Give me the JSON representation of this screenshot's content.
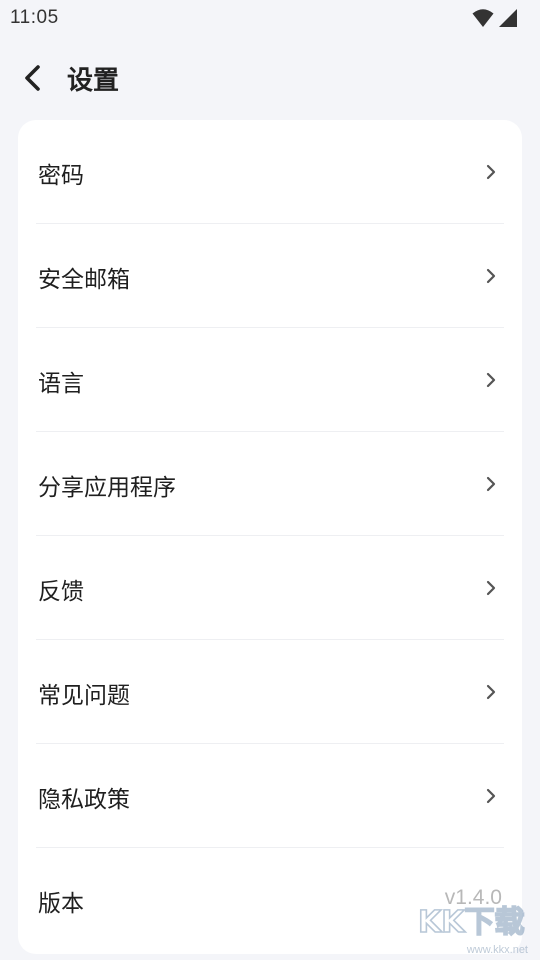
{
  "status_bar": {
    "time": "11:05",
    "icons": [
      "wifi-icon",
      "signal-icon"
    ]
  },
  "header": {
    "back_icon": "chevron-left-icon",
    "title": "设置"
  },
  "settings": {
    "items": [
      {
        "label": "密码",
        "icon": "chevron-right-icon"
      },
      {
        "label": "安全邮箱",
        "icon": "chevron-right-icon"
      },
      {
        "label": "语言",
        "icon": "chevron-right-icon"
      },
      {
        "label": "分享应用程序",
        "icon": "chevron-right-icon"
      },
      {
        "label": "反馈",
        "icon": "chevron-right-icon"
      },
      {
        "label": "常见问题",
        "icon": "chevron-right-icon"
      },
      {
        "label": "隐私政策",
        "icon": "chevron-right-icon"
      },
      {
        "label": "版本",
        "value": "v1.4.0"
      }
    ]
  },
  "watermark": {
    "logo_text": "KK下载",
    "url": "www.kkx.net"
  },
  "colors": {
    "background": "#f4f5f9",
    "card": "#ffffff",
    "text": "#1f1f1f",
    "secondary_text": "#b8b8b8",
    "chevron": "#555555"
  }
}
